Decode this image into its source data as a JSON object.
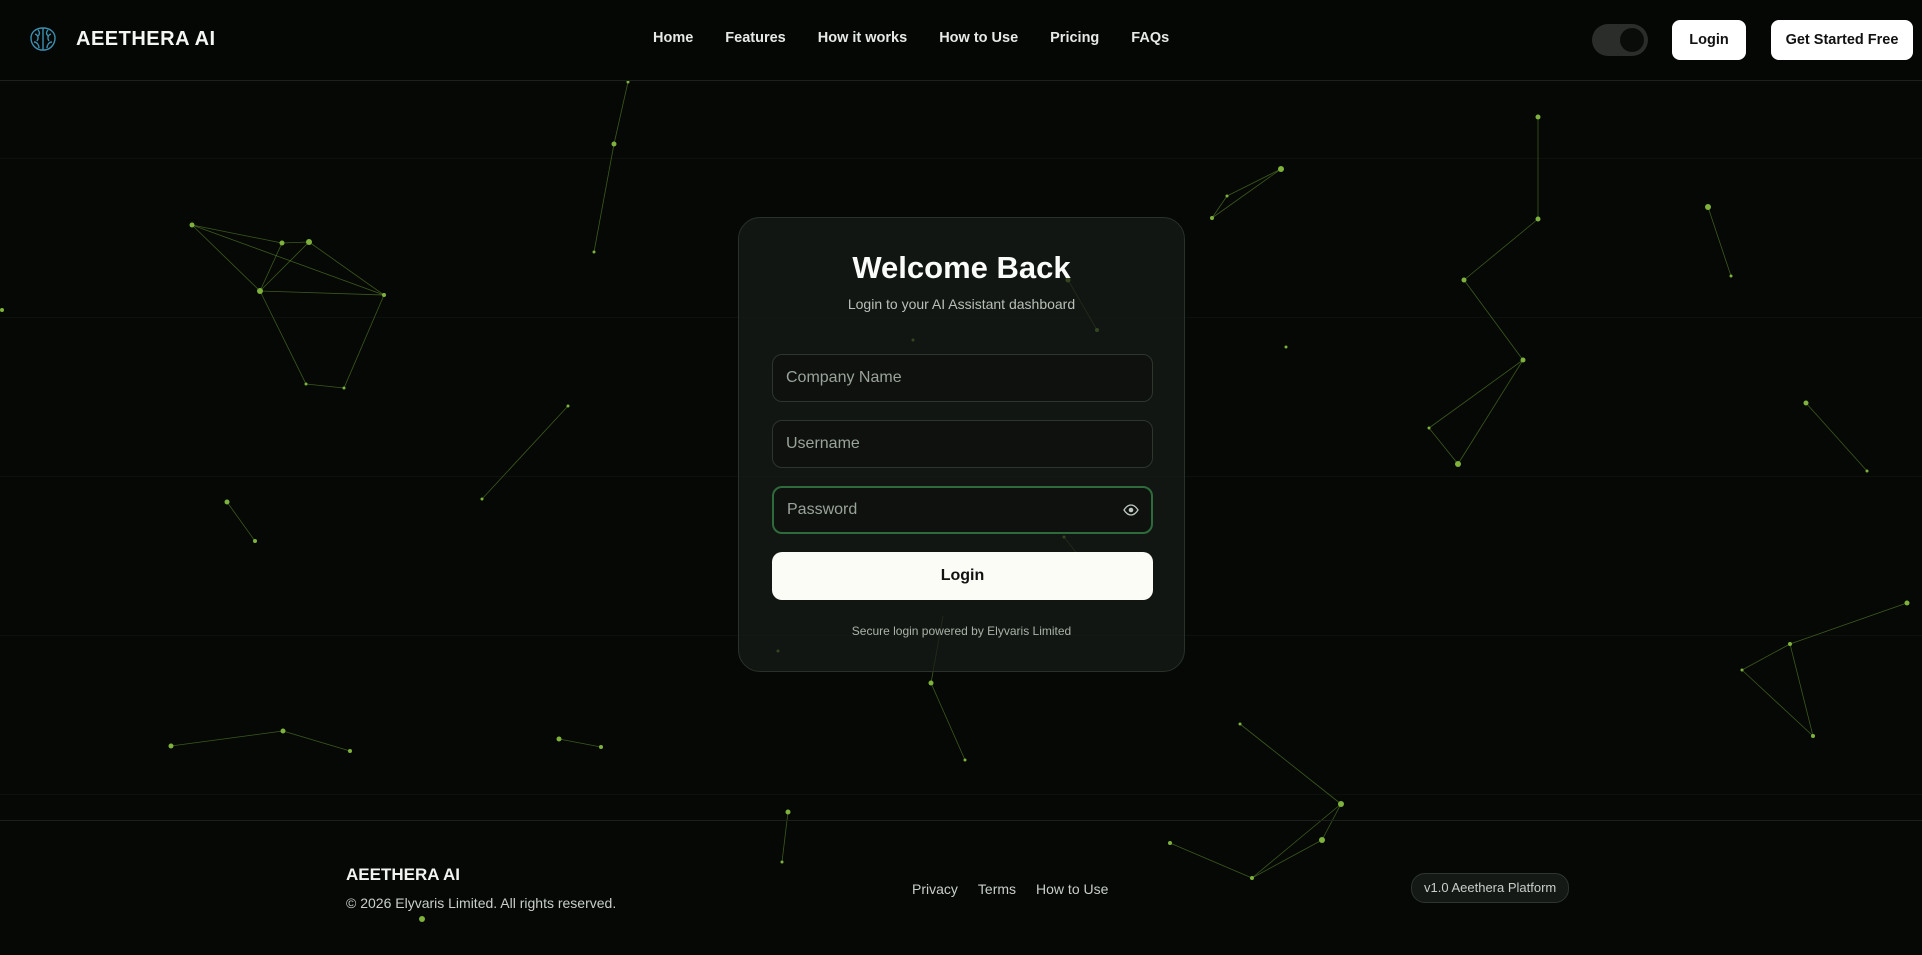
{
  "header": {
    "brand": "AEETHERA AI",
    "nav": [
      "Home",
      "Features",
      "How it works",
      "How to Use",
      "Pricing",
      "FAQs"
    ],
    "login_label": "Login",
    "get_started_label": "Get Started Free"
  },
  "login_card": {
    "title": "Welcome Back",
    "subtitle": "Login to your AI Assistant dashboard",
    "company_placeholder": "Company Name",
    "username_placeholder": "Username",
    "password_placeholder": "Password",
    "submit_label": "Login",
    "secure_note": "Secure login powered by Elyvaris Limited"
  },
  "footer": {
    "brand": "AEETHERA AI",
    "copyright": "© 2026 Elyvaris Limited. All rights reserved.",
    "links": [
      "Privacy",
      "Terms",
      "How to Use"
    ],
    "version_badge": "v1.0 Aeethera Platform"
  },
  "colors": {
    "background": "#050805",
    "accent_green": "#7fb23a",
    "focus_border": "#2f6a3c"
  },
  "icons": {
    "brand": "brain-logo-icon",
    "password_toggle": "eye-icon"
  }
}
